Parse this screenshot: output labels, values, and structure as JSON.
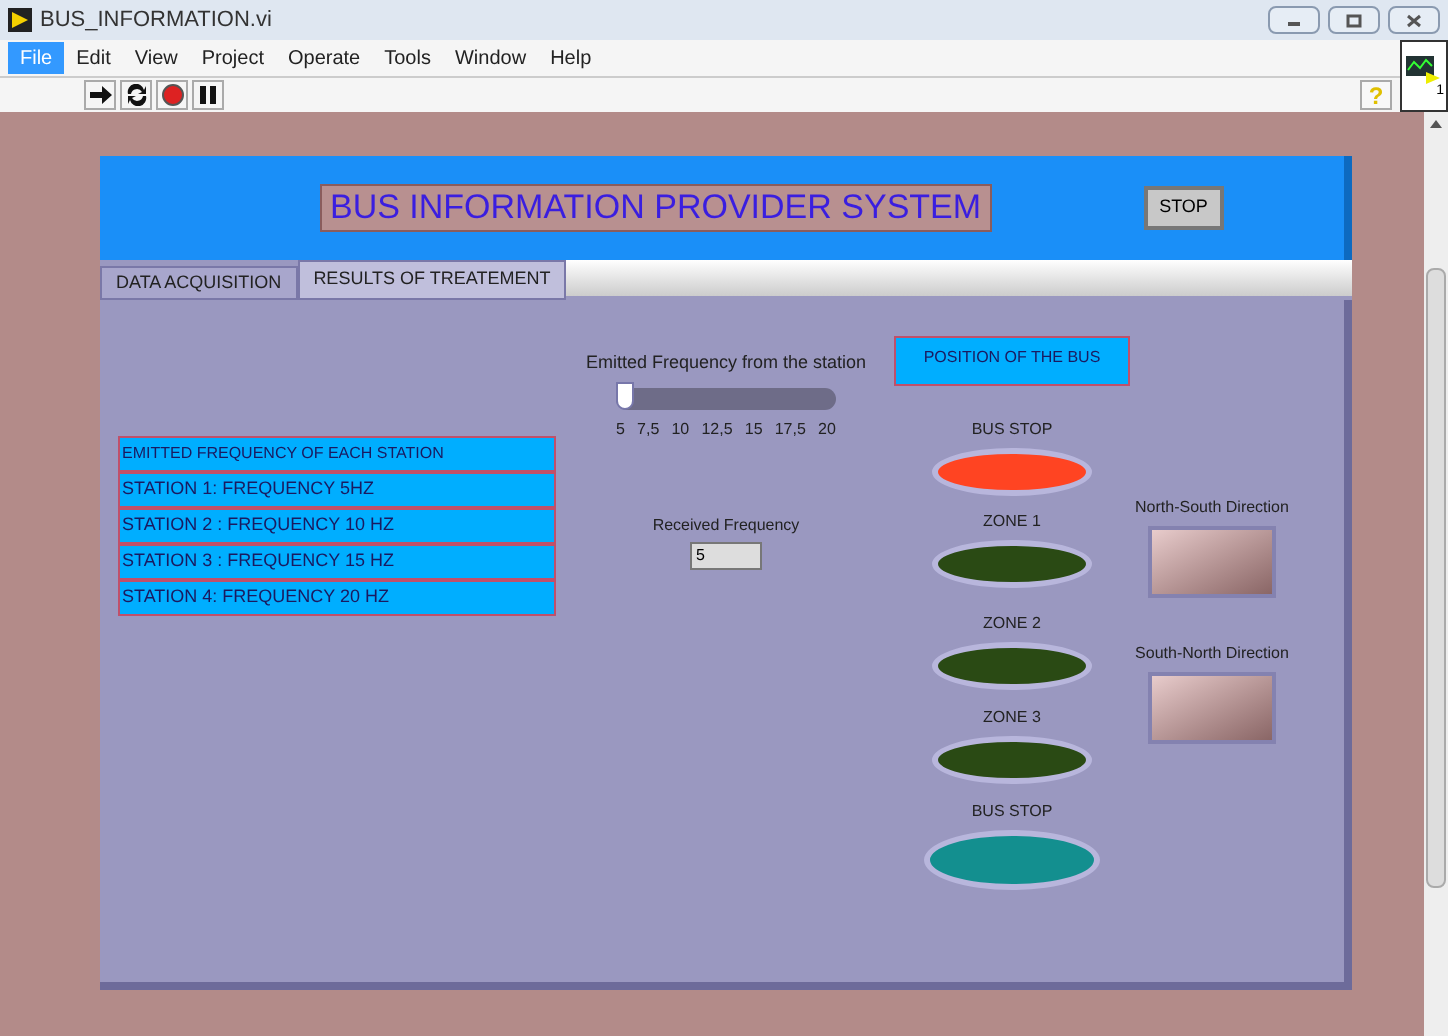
{
  "window": {
    "title": "BUS_INFORMATION.vi"
  },
  "menu": [
    {
      "label": "File",
      "selected": true
    },
    {
      "label": "Edit",
      "selected": false
    },
    {
      "label": "View",
      "selected": false
    },
    {
      "label": "Project",
      "selected": false
    },
    {
      "label": "Operate",
      "selected": false
    },
    {
      "label": "Tools",
      "selected": false
    },
    {
      "label": "Window",
      "selected": false
    },
    {
      "label": "Help",
      "selected": false
    }
  ],
  "toolbar": {
    "help": "?",
    "connector_count": "1"
  },
  "header": {
    "title": "BUS INFORMATION PROVIDER SYSTEM",
    "stop_button": "STOP"
  },
  "tabs": [
    {
      "label": "DATA ACQUISITION",
      "selected": false
    },
    {
      "label": "RESULTS OF TREATEMENT",
      "selected": true
    }
  ],
  "station_table": {
    "heading": "EMITTED FREQUENCY  OF EACH STATION",
    "rows": [
      "STATION 1: FREQUENCY 5HZ",
      "STATION  2 : FREQUENCY 10 HZ",
      "STATION 3 : FREQUENCY 15 HZ",
      "STATION 4:  FREQUENCY 20 HZ"
    ]
  },
  "slider": {
    "label": "Emitted Frequency from the station",
    "level": 0,
    "ticks": [
      "5",
      "7,5",
      "10",
      "12,5",
      "15",
      "17,5",
      "20"
    ]
  },
  "received": {
    "label": "Received Frequency",
    "value": "5"
  },
  "position": {
    "heading": "POSITION OF THE BUS",
    "leds": [
      {
        "label": "BUS STOP",
        "color": "#ff4422"
      },
      {
        "label": "ZONE 1",
        "color": "#2a4a14"
      },
      {
        "label": "ZONE 2",
        "color": "#2a4a14"
      },
      {
        "label": "ZONE 3",
        "color": "#2a4a14"
      },
      {
        "label": "BUS STOP",
        "color": "#138f8f"
      }
    ]
  },
  "directions": [
    {
      "label": "North-South  Direction",
      "on": false
    },
    {
      "label": "South-North Direction",
      "on": false
    }
  ]
}
